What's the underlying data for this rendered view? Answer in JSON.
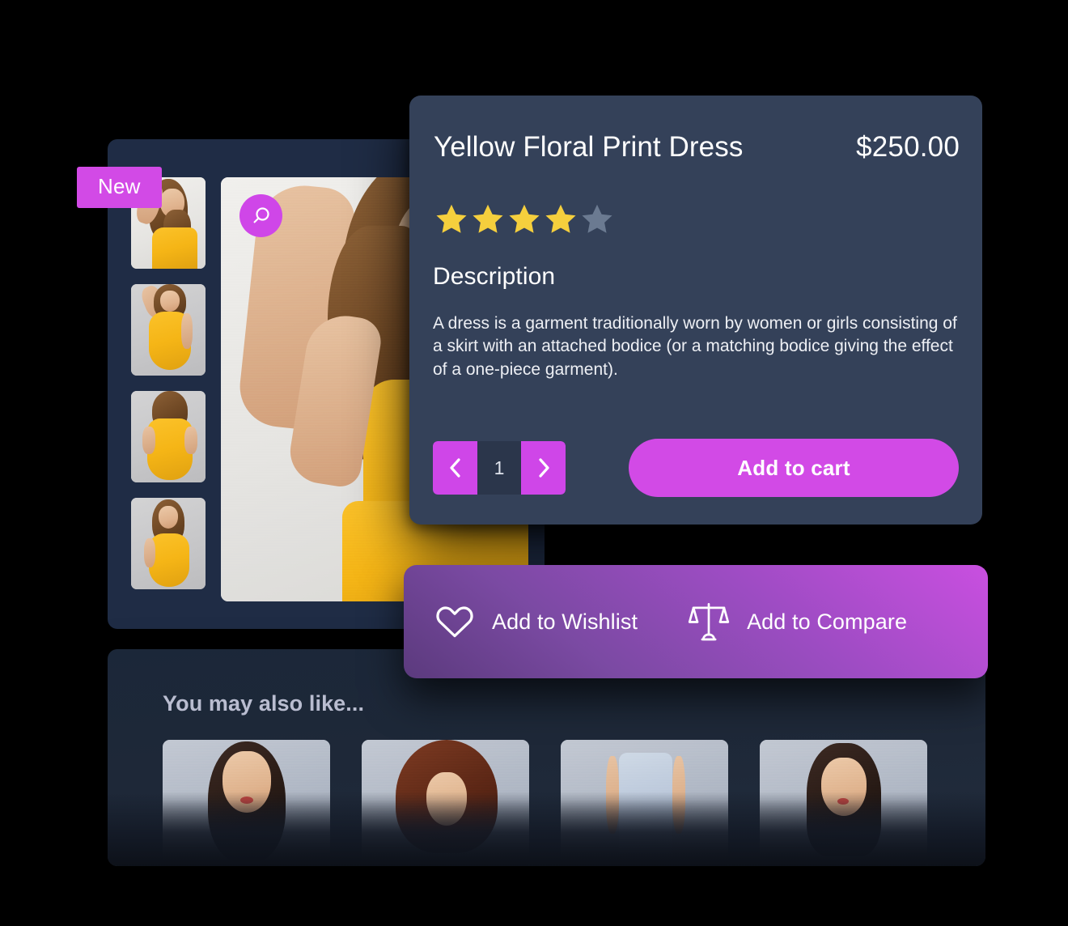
{
  "product": {
    "title": "Yellow Floral Print Dress",
    "price": "$250.00",
    "badge": "New",
    "rating": {
      "value": 4,
      "max": 5,
      "filled_color": "#f5cf3d",
      "empty_color": "#6b7a91"
    },
    "description_heading": "Description",
    "description": "A dress is a garment traditionally worn by women or girls consisting of a skirt with an attached bodice (or a matching bodice giving the effect of a one-piece garment)."
  },
  "gallery": {
    "zoom_icon": "magnifier-icon",
    "thumbnails": [
      {
        "alt": "Model in yellow lace dress, hand on head, front view"
      },
      {
        "alt": "Model in yellow lace dress, arm raised, front view"
      },
      {
        "alt": "Model in yellow lace dress, back view"
      },
      {
        "alt": "Model in yellow lace dress, three-quarter view"
      }
    ],
    "main_image": {
      "alt": "Model wearing yellow floral lace dress, hand in hair"
    }
  },
  "purchase": {
    "quantity": "1",
    "decrement_icon": "chevron-left-icon",
    "increment_icon": "chevron-right-icon",
    "add_to_cart_label": "Add to cart"
  },
  "actions": {
    "wishlist": {
      "label": "Add to Wishlist",
      "icon": "heart-icon"
    },
    "compare": {
      "label": "Add to Compare",
      "icon": "scales-icon"
    }
  },
  "recommendations": {
    "title": "You may also like...",
    "items": [
      {
        "alt": "Woman with dark hair and red lipstick"
      },
      {
        "alt": "Woman with curly auburn hair"
      },
      {
        "alt": "Woman in light denim dress"
      },
      {
        "alt": "Woman with dark bob haircut"
      }
    ]
  },
  "theme": {
    "card_bg": "#344159",
    "panel_bg": "#1f2c45",
    "recommend_bg": "#1e2838",
    "accent": "#d24ae6",
    "accent_bright": "#cf46e8",
    "text_primary": "#ffffff",
    "text_muted": "#b9bdd0"
  }
}
